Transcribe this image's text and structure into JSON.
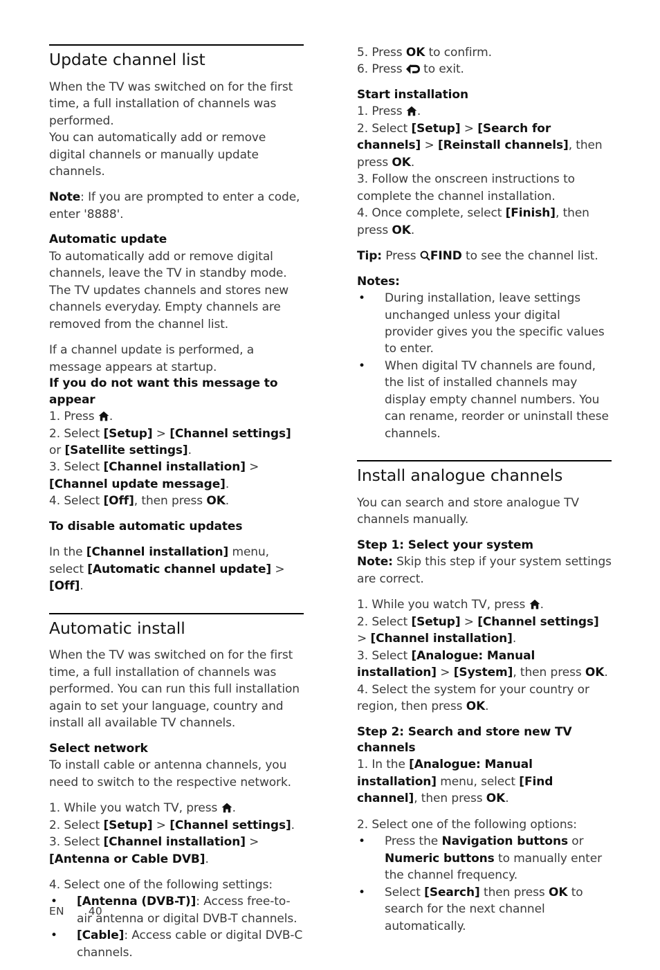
{
  "footer": {
    "language": "EN",
    "page_number": "40"
  },
  "icons": {
    "home": "home-icon",
    "back": "back-arrow-icon",
    "find": "search-find-icon"
  },
  "left_column": {
    "section1": {
      "heading": "Update channel list",
      "p1": "When the TV was switched on for the first time, a full installation of channels was performed.",
      "p2": "You can automatically add or remove digital channels or manually update channels.",
      "note_label": "Note",
      "note_text": ": If you are prompted to enter a code, enter '8888'.",
      "sub1": "Automatic update",
      "p3": "To automatically add or remove digital channels, leave the TV in standby mode. The TV updates channels and stores new channels everyday. Empty channels are removed from the channel list.",
      "p4": "If a channel update is performed, a message appears at startup.",
      "sub2": "If you do not want this message to appear",
      "step1_pre": "1. Press ",
      "step1_post": ".",
      "step2_pre": "2. Select ",
      "step2_b1": "[Setup]",
      "step2_mid": " > ",
      "step2_b2": "[Channel settings]",
      "step2_or": " or ",
      "step2_b3": "[Satellite settings]",
      "step2_post": ".",
      "step3_pre": "3. Select ",
      "step3_b1": "[Channel installation]",
      "step3_mid": " > ",
      "step3_b2": "[Channel update message]",
      "step3_post": ".",
      "step4_pre": "4. Select ",
      "step4_b1": "[Off]",
      "step4_mid": ", then press ",
      "step4_b2": "OK",
      "step4_post": ".",
      "sub3": "To disable automatic updates",
      "p5_pre": "In the ",
      "p5_b1": "[Channel installation]",
      "p5_mid": " menu, select ",
      "p5_b2": "[Automatic channel update]",
      "p5_mid2": " > ",
      "p5_b3": "[Off]",
      "p5_post": "."
    },
    "section2": {
      "heading": "Automatic install",
      "p1": "When the TV was switched on for the first time, a full installation of channels was performed. You can run this full installation again to set your language, country and install all available TV channels.",
      "sub1": "Select network",
      "p2": "To install cable or antenna channels, you need to switch to the respective network.",
      "step1_pre": "1. While you watch TV, press ",
      "step1_post": ".",
      "step2_pre": "2. Select ",
      "step2_b1": "[Setup]",
      "step2_mid": " > ",
      "step2_b2": "[Channel settings]",
      "step2_post": ".",
      "step3_pre": "3. Select ",
      "step3_b1": "[Channel installation]",
      "step3_mid": " > ",
      "step3_b2": "[Antenna or Cable DVB]",
      "step3_post": ".",
      "step4": "4. Select one of the following settings:",
      "bullets": [
        {
          "bold": "[Antenna (DVB-T)]",
          "rest": ": Access free-to-air antenna or digital DVB-T channels."
        },
        {
          "bold": "[Cable]",
          "rest": ": Access cable or digital DVB-C channels."
        }
      ]
    }
  },
  "right_column": {
    "section1": {
      "step5_pre": "5. Press ",
      "step5_b1": "OK",
      "step5_post": " to confirm.",
      "step6_pre": "6. Press ",
      "step6_post": " to exit.",
      "sub1": "Start installation",
      "step1_pre": "1. Press ",
      "step1_post": ".",
      "step2_pre": "2. Select ",
      "step2_b1": "[Setup]",
      "step2_mid": " > ",
      "step2_b2": "[Search for channels]",
      "step2_mid2": " > ",
      "step2_b3": "[Reinstall channels]",
      "step2_mid3": ", then press ",
      "step2_b4": "OK",
      "step2_post": ".",
      "step3": "3. Follow the onscreen instructions to complete the channel installation.",
      "step4_pre": "4. Once complete, select ",
      "step4_b1": "[Finish]",
      "step4_mid": ", then press ",
      "step4_b2": "OK",
      "step4_post": ".",
      "tip_label": "Tip:",
      "tip_pre": " Press ",
      "tip_b1": "FIND",
      "tip_post": " to see the channel list.",
      "notes_label": "Notes:",
      "notes": [
        "During installation, leave settings unchanged unless your digital provider gives you the specific values to enter.",
        "When digital TV channels are found, the list of installed channels may display empty channel numbers. You can rename, reorder or uninstall these channels."
      ]
    },
    "section2": {
      "heading": "Install analogue channels",
      "p1": "You can search and store analogue TV channels manually.",
      "sub1": "Step 1: Select your system",
      "note_label": "Note:",
      "note_text": " Skip this step if your system settings are correct.",
      "step1_pre": "1. While you watch TV, press ",
      "step1_post": ".",
      "step2_pre": "2. Select ",
      "step2_b1": "[Setup]",
      "step2_mid": " > ",
      "step2_b2": "[Channel settings]",
      "step2_mid2": " > ",
      "step2_b3": "[Channel installation]",
      "step2_post": ".",
      "step3_pre": "3. Select ",
      "step3_b1": "[Analogue: Manual installation]",
      "step3_mid": " > ",
      "step3_b2": "[System]",
      "step3_mid2": ", then press ",
      "step3_b3": "OK",
      "step3_post": ".",
      "step4_pre": "4. Select the system for your country or region, then press ",
      "step4_b1": "OK",
      "step4_post": ".",
      "sub2": "Step 2: Search and store new TV channels",
      "s2_step1_pre": "1. In the ",
      "s2_step1_b1": "[Analogue: Manual installation]",
      "s2_step1_mid": " menu, select ",
      "s2_step1_b2": "[Find channel]",
      "s2_step1_mid2": ", then press ",
      "s2_step1_b3": "OK",
      "s2_step1_post": ".",
      "s2_step2": "2. Select one of the following options:",
      "bullets": [
        {
          "pre": "Press the ",
          "b1": "Navigation buttons",
          "mid": " or ",
          "b2": "Numeric buttons",
          "post": " to manually enter the channel frequency."
        },
        {
          "pre": "Select ",
          "b1": "[Search]",
          "mid": " then press ",
          "b2": "OK",
          "post": " to search for the next channel automatically."
        }
      ]
    }
  }
}
